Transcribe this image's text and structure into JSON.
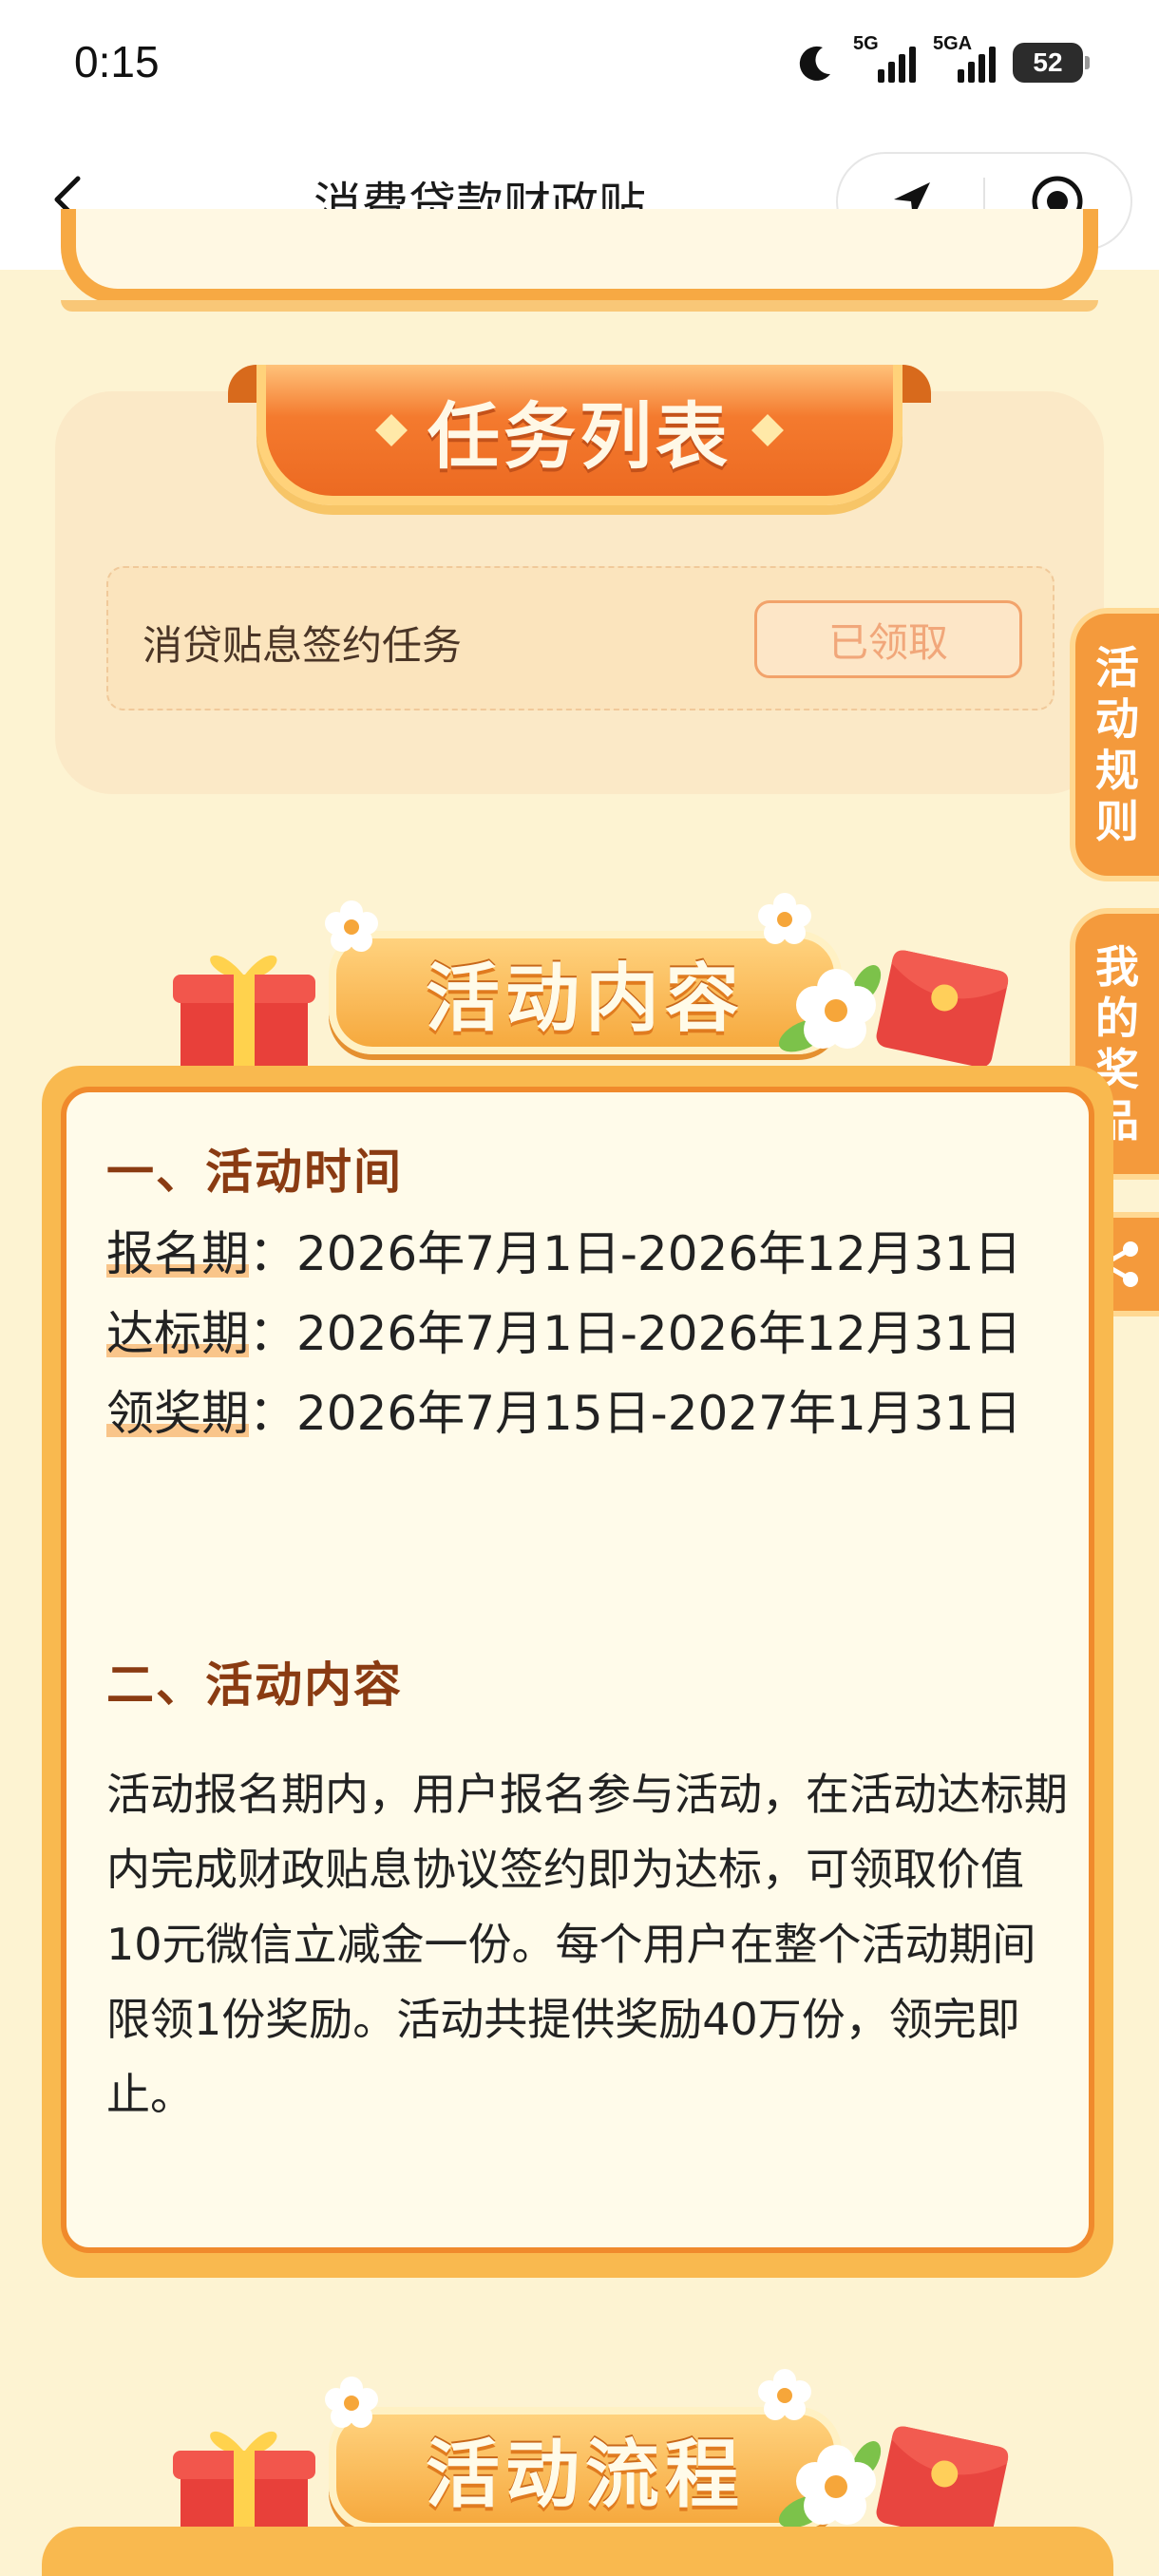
{
  "status_bar": {
    "time": "0:15",
    "net1": "5G",
    "net2": "5GA",
    "battery": "52"
  },
  "nav": {
    "title": "消费贷款财政贴…"
  },
  "task_section": {
    "title": "任务列表",
    "tasks": [
      {
        "name": "消贷贴息签约任务",
        "status": "已领取"
      }
    ]
  },
  "side_tabs": {
    "rules": [
      "活",
      "动",
      "规",
      "则"
    ],
    "prizes": [
      "我",
      "的",
      "奖",
      "品"
    ]
  },
  "content_section": {
    "title": "活动内容",
    "time_heading": "一、活动时间",
    "periods": [
      {
        "label": "报名期",
        "value": "：2026年7月1日-2026年12月31日"
      },
      {
        "label": "达标期",
        "value": "：2026年7月1日-2026年12月31日"
      },
      {
        "label": "领奖期",
        "value": "：2026年7月15日-2027年1月31日"
      }
    ],
    "content_heading": "二、活动内容",
    "paragraph": "活动报名期内，用户报名参与活动，在活动达标期内完成财政贴息协议签约即为达标，可领取价值10元微信立减金一份。每个用户在整个活动期间限领1份奖励。活动共提供奖励40万份，领完即止。"
  },
  "process_section": {
    "title": "活动流程"
  },
  "colors": {
    "page_bg": "#fdf3d2",
    "accent_orange": "#f47a2e",
    "card_border": "#f9b94f",
    "heading_brown": "#8a3b12"
  }
}
